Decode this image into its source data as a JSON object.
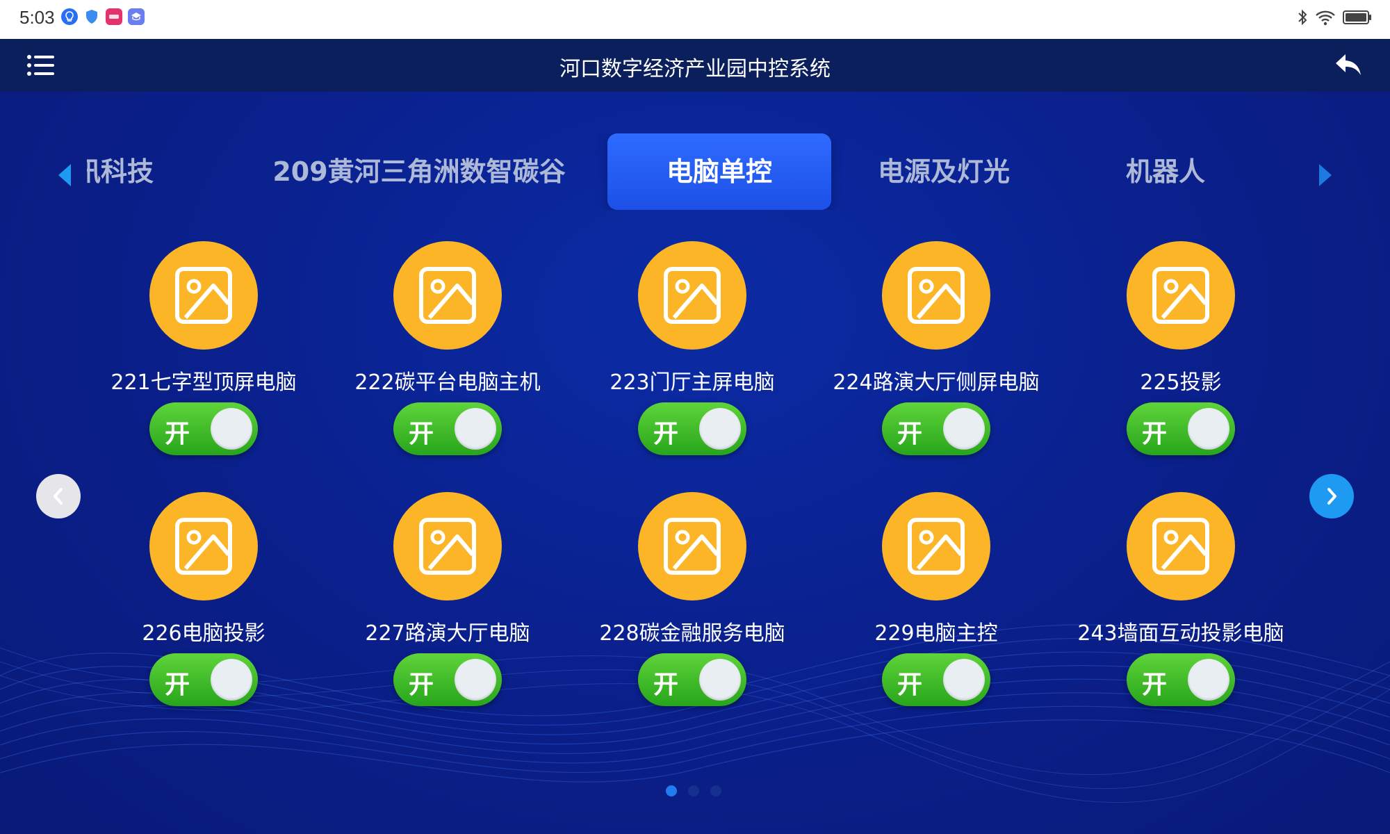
{
  "status_bar": {
    "time": "5:03"
  },
  "header": {
    "title": "河口数字经济产业园中控系统"
  },
  "tabs": [
    {
      "label": "讯科技"
    },
    {
      "label": "209黄河三角洲数智碳谷"
    },
    {
      "label": "电脑单控",
      "active": true
    },
    {
      "label": "电源及灯光"
    },
    {
      "label": "机器人"
    }
  ],
  "devices": [
    {
      "label": "221七字型顶屏电脑",
      "switch_label": "开"
    },
    {
      "label": "222碳平台电脑主机",
      "switch_label": "开"
    },
    {
      "label": "223门厅主屏电脑",
      "switch_label": "开"
    },
    {
      "label": "224路演大厅侧屏电脑",
      "switch_label": "开"
    },
    {
      "label": "225投影",
      "switch_label": "开"
    },
    {
      "label": "226电脑投影",
      "switch_label": "开"
    },
    {
      "label": "227路演大厅电脑",
      "switch_label": "开"
    },
    {
      "label": "228碳金融服务电脑",
      "switch_label": "开"
    },
    {
      "label": "229电脑主控",
      "switch_label": "开"
    },
    {
      "label": "243墙面互动投影电脑",
      "switch_label": "开"
    }
  ],
  "pagination": {
    "total": 3,
    "current": 1
  },
  "colors": {
    "accent": "#1c50e6",
    "icon_bg": "#fbb526",
    "switch_on": "#27a51b",
    "next_button": "#1e9af2"
  },
  "icons": {
    "menu": "menu-icon",
    "back": "back-arrow-icon",
    "device": "image-placeholder-icon",
    "tab_prev": "triangle-left-icon",
    "tab_next": "triangle-right-icon",
    "page_prev": "chevron-left-icon",
    "page_next": "chevron-right-icon"
  }
}
